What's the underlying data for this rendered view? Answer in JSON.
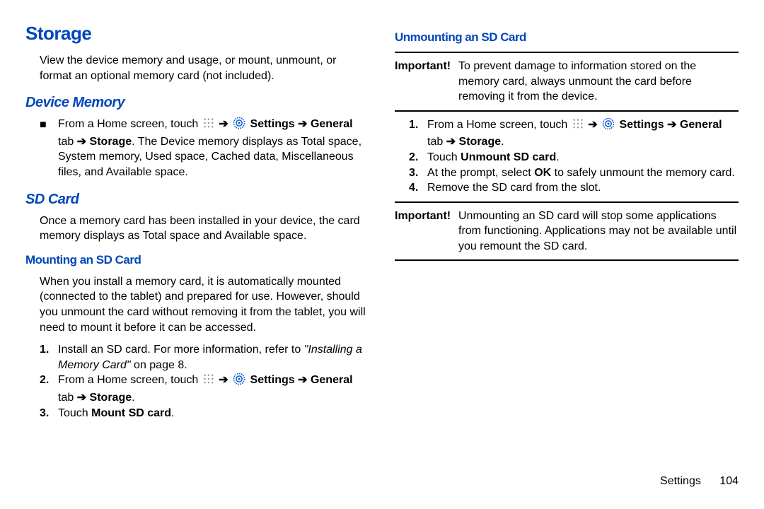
{
  "col1": {
    "h1": "Storage",
    "intro": "View the device memory and usage, or mount, unmount, or format an optional memory card (not included).",
    "h2a": "Device Memory",
    "dm_pre": "From a Home screen, touch ",
    "dm_settings": "Settings",
    "dm_general": "General",
    "dm_tab": " tab ",
    "dm_storage": "Storage",
    "dm_post": ". The Device memory displays as Total space, System memory, Used space, Cached data, Miscellaneous files, and Available space.",
    "h2b": "SD Card",
    "sd_intro": "Once a memory card has been installed in your device, the card memory displays as Total space and Available space.",
    "h3a": "Mounting an SD Card",
    "mount_intro": "When you install a memory card, it is automatically mounted (connected to the tablet) and prepared for use. However, should you unmount the card without removing it from the tablet, you will need to mount it before it can be accessed.",
    "m1a": "Install an SD card. For more information, refer to ",
    "m1b": "\"Installing a Memory Card\"",
    "m1c": " on page 8.",
    "m2_pre": "From a Home screen, touch ",
    "m2_settings": "Settings",
    "m2_general": "General",
    "m2_tab": " tab ",
    "m2_storage": "Storage",
    "m3a": "Touch ",
    "m3b": "Mount SD card"
  },
  "col2": {
    "h3b": "Unmounting an SD Card",
    "imp1_lbl": "Important!",
    "imp1_txt": "To prevent damage to information stored on the memory card, always unmount the card before removing it from the device.",
    "u1_pre": "From a Home screen, touch ",
    "u1_settings": "Settings",
    "u1_general": "General",
    "u1_tab": " tab ",
    "u1_storage": "Storage",
    "u2a": "Touch ",
    "u2b": "Unmount SD card",
    "u3a": "At the prompt, select ",
    "u3ok": "OK",
    "u3b": " to safely unmount the memory card.",
    "u4": "Remove the SD card from the slot.",
    "imp2_lbl": "Important!",
    "imp2_txt": "Unmounting an SD card will stop some applications from functioning. Applications may not be available until you remount the SD card."
  },
  "footer": {
    "section": "Settings",
    "page": "104"
  },
  "marks": {
    "arrow": "➔",
    "square": "■",
    "n1": "1.",
    "n2": "2.",
    "n3": "3.",
    "n4": "4.",
    "dot": "."
  }
}
